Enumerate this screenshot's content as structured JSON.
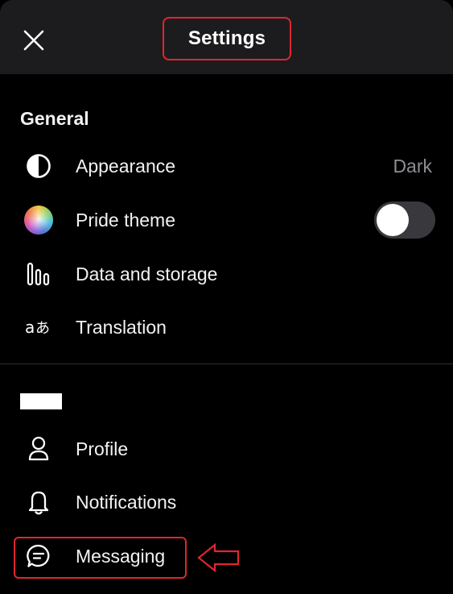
{
  "header": {
    "title": "Settings",
    "close_icon": "close-icon"
  },
  "sections": {
    "general": {
      "title": "General",
      "items": [
        {
          "label": "Appearance",
          "value": "Dark",
          "icon": "half-circle-icon"
        },
        {
          "label": "Pride theme",
          "toggle": false,
          "icon": "rainbow-circle-icon"
        },
        {
          "label": "Data and storage",
          "icon": "bars-icon"
        },
        {
          "label": "Translation",
          "icon": "translate-icon"
        }
      ]
    },
    "account": {
      "title_redacted": true,
      "items": [
        {
          "label": "Profile",
          "icon": "person-icon"
        },
        {
          "label": "Notifications",
          "icon": "bell-icon"
        },
        {
          "label": "Messaging",
          "icon": "chat-bubble-icon"
        }
      ]
    }
  },
  "colors": {
    "background": "#000000",
    "header": "#1c1c1e",
    "highlight": "#e0262e",
    "secondary_text": "#8e8e93",
    "toggle_off": "#39393d"
  }
}
